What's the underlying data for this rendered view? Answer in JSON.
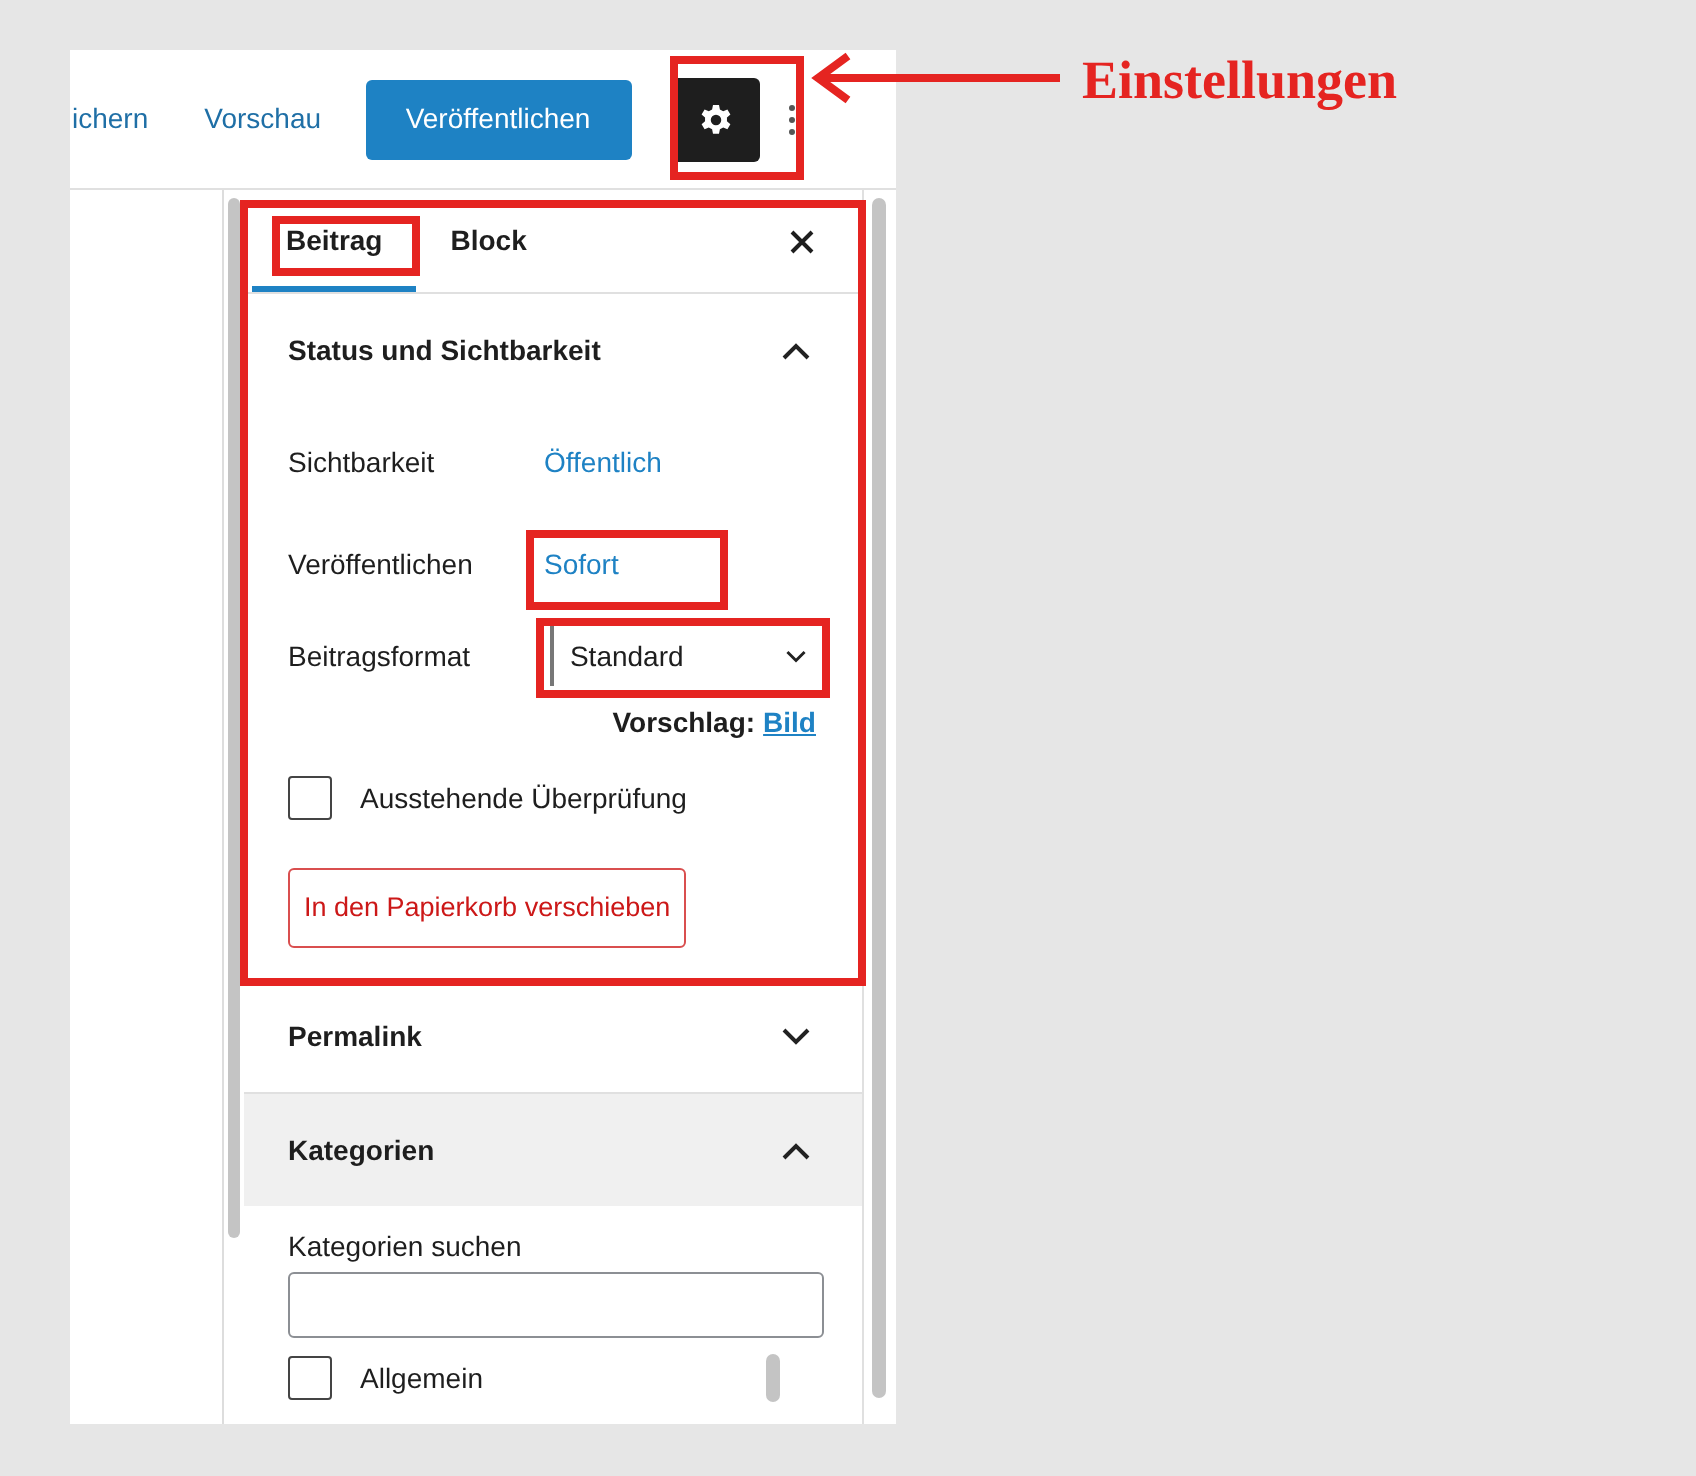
{
  "toolbar": {
    "save_link": "ichern",
    "preview_link": "Vorschau",
    "publish_button": "Veröffentlichen",
    "settings_button": {
      "pressed": true
    }
  },
  "sidebar": {
    "tabs": [
      {
        "label": "Beitrag",
        "selected": true
      },
      {
        "label": "Block",
        "selected": false
      }
    ],
    "panels": [
      {
        "kind": "status",
        "title": "Status und Sichtbarkeit",
        "expanded": true,
        "highlighted": false,
        "rows": [
          {
            "kind": "link",
            "label": "Sichtbarkeit",
            "value": "Öffentlich"
          },
          {
            "kind": "link",
            "label": "Veröffentlichen",
            "value": "Sofort"
          },
          {
            "kind": "select",
            "label": "Beitragsformat",
            "value": "Standard"
          }
        ],
        "suggestion": {
          "text": "Vorschlag:",
          "link": "Bild"
        },
        "pending_review": {
          "label": "Ausstehende Überprüfung",
          "checked": false
        },
        "trash_button": "In den Papierkorb verschieben"
      },
      {
        "title": "Permalink",
        "expanded": false,
        "highlighted": false
      },
      {
        "kind": "categories",
        "title": "Kategorien",
        "expanded": true,
        "highlighted": true,
        "search_label": "Kategorien suchen",
        "items": [
          {
            "label": "Allgemein",
            "checked": false
          }
        ]
      }
    ]
  },
  "callout": {
    "label": "Einstellungen"
  }
}
